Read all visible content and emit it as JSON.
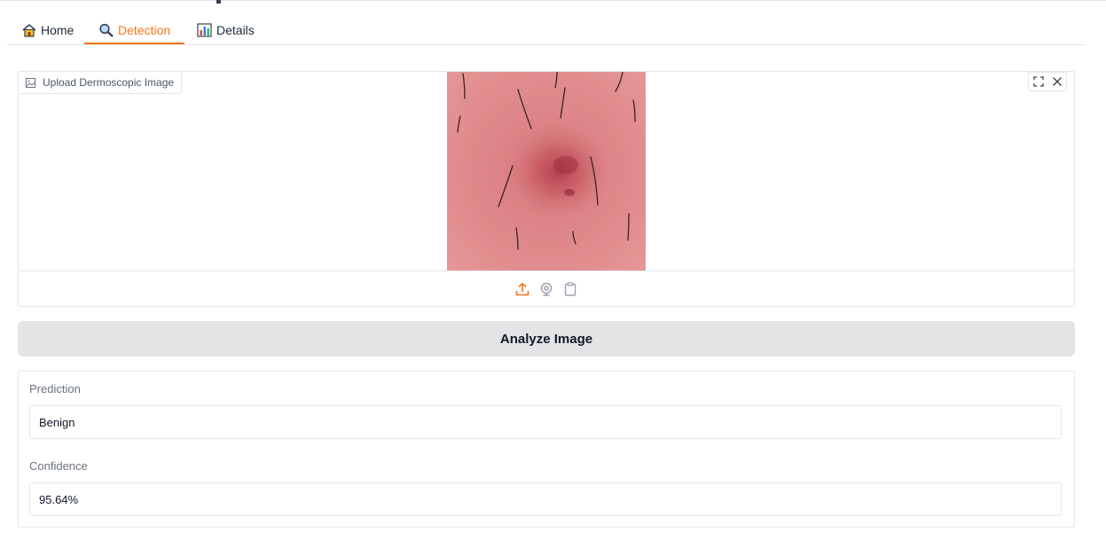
{
  "tabs": [
    {
      "label": "Home",
      "icon": "house-icon",
      "active": false
    },
    {
      "label": "Detection",
      "icon": "magnifier-icon",
      "active": true
    },
    {
      "label": "Details",
      "icon": "bar-chart-icon",
      "active": false
    }
  ],
  "image_input": {
    "label": "Upload Dermoscopic Image",
    "sources": [
      "upload-icon",
      "webcam-icon",
      "clipboard-icon"
    ],
    "tools": [
      "fullscreen-icon",
      "close-icon"
    ]
  },
  "analyze_button": {
    "label": "Analyze Image"
  },
  "outputs": {
    "prediction": {
      "label": "Prediction",
      "value": "Benign"
    },
    "confidence": {
      "label": "Confidence",
      "value": "95.64%"
    }
  },
  "colors": {
    "accent": "#f97316",
    "button_bg": "#e4e4e7",
    "border": "#e5e7eb"
  }
}
